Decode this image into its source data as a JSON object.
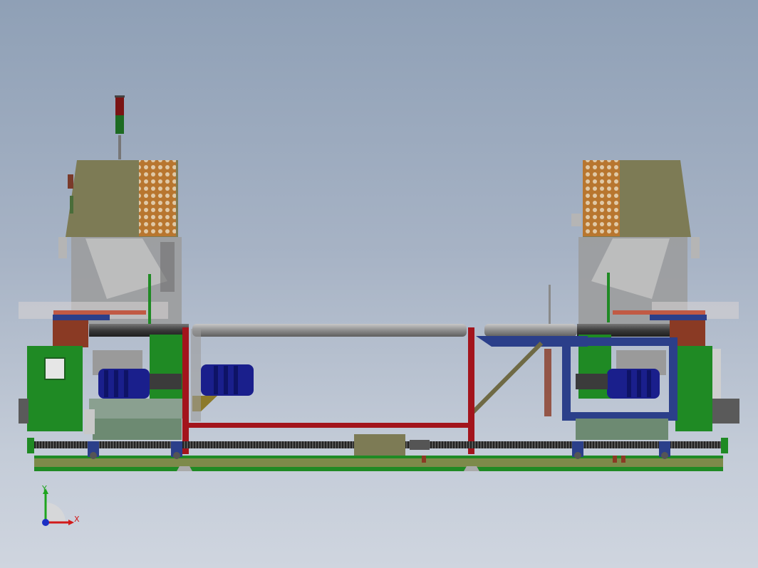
{
  "view": {
    "orientation": {
      "y_label": "Y",
      "x_label": "X"
    }
  },
  "colors": {
    "background_top": "#8fa0b6",
    "background_bottom": "#cfd5df",
    "cabinet": "#7d7b55",
    "perforated_panel": "#b8762f",
    "frame_red": "#a3141c",
    "motor_blue": "#1a1f8c",
    "base_green": "#1f7a24",
    "shaft_gray": "#8e8e8e",
    "bracket_blue": "#2b3f8a",
    "axis_x": "#d11a1a",
    "axis_y": "#1ea51e",
    "axis_z": "#1b2fc4"
  },
  "icons": {
    "triad": "coordinate-triad-icon",
    "signal_tower": "signal-tower-icon"
  }
}
